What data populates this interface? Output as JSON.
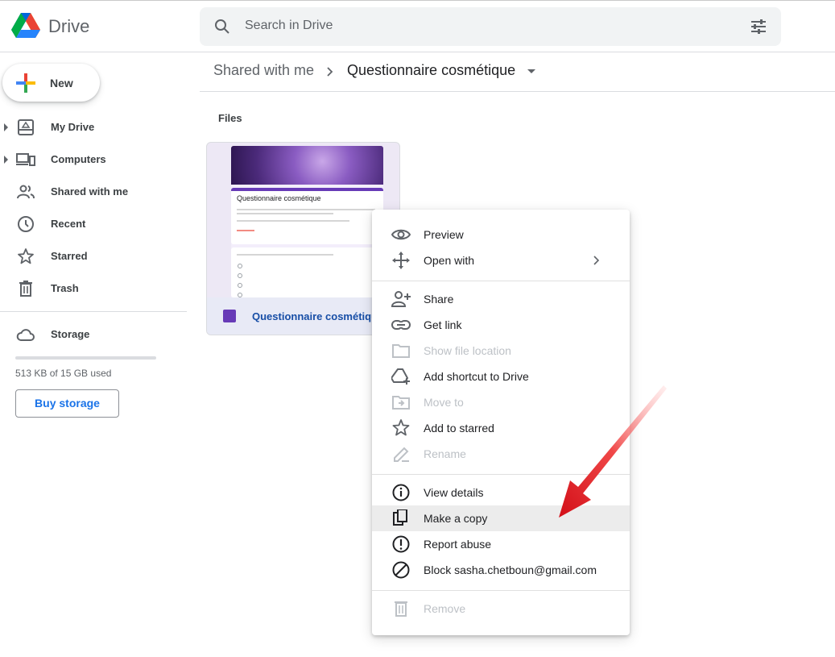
{
  "header": {
    "app_name": "Drive",
    "search_placeholder": "Search in Drive"
  },
  "sidebar": {
    "new_label": "New",
    "items": [
      {
        "label": "My Drive",
        "icon": "my-drive-icon"
      },
      {
        "label": "Computers",
        "icon": "computers-icon"
      },
      {
        "label": "Shared with me",
        "icon": "shared-icon"
      },
      {
        "label": "Recent",
        "icon": "clock-icon"
      },
      {
        "label": "Starred",
        "icon": "star-icon"
      },
      {
        "label": "Trash",
        "icon": "trash-icon"
      }
    ],
    "storage_label": "Storage",
    "storage_used": "513 KB of 15 GB used",
    "storage_fraction": 0.0001,
    "buy_storage": "Buy storage"
  },
  "breadcrumb": {
    "parent": "Shared with me",
    "current": "Questionnaire cosmétique"
  },
  "files": {
    "section_label": "Files",
    "items": [
      {
        "name": "Questionnaire cosmétique",
        "thumb_title": "Questionnaire cosmétique"
      }
    ]
  },
  "context_menu": {
    "items": [
      {
        "label": "Preview",
        "icon": "eye-icon",
        "enabled": true
      },
      {
        "label": "Open with",
        "icon": "move-arrows-icon",
        "enabled": true,
        "submenu": true
      },
      {
        "label": "Share",
        "icon": "person-add-icon",
        "enabled": true
      },
      {
        "label": "Get link",
        "icon": "link-icon",
        "enabled": true
      },
      {
        "label": "Show file location",
        "icon": "folder-icon",
        "enabled": false
      },
      {
        "label": "Add shortcut to Drive",
        "icon": "add-shortcut-icon",
        "enabled": true
      },
      {
        "label": "Move to",
        "icon": "move-to-folder-icon",
        "enabled": false
      },
      {
        "label": "Add to starred",
        "icon": "star-icon",
        "enabled": true
      },
      {
        "label": "Rename",
        "icon": "pencil-icon",
        "enabled": false
      },
      {
        "label": "View details",
        "icon": "info-icon",
        "enabled": true
      },
      {
        "label": "Make a copy",
        "icon": "copy-icon",
        "enabled": true,
        "highlighted": true
      },
      {
        "label": "Report abuse",
        "icon": "report-icon",
        "enabled": true
      },
      {
        "label": "Block sasha.chetboun@gmail.com",
        "icon": "block-icon",
        "enabled": true
      },
      {
        "label": "Remove",
        "icon": "trash-icon",
        "enabled": false
      }
    ]
  },
  "colors": {
    "accent": "#1a73e8",
    "forms_purple": "#673ab7",
    "annotation_red": "#e8141c"
  }
}
